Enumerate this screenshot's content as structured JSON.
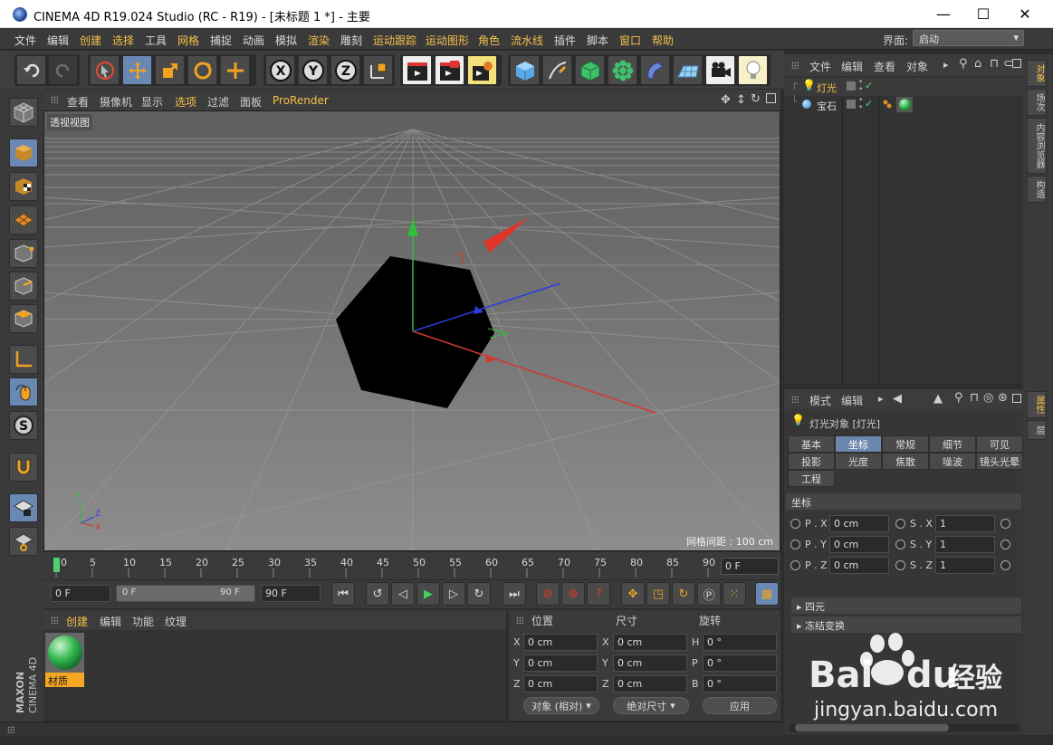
{
  "window": {
    "title": "CINEMA 4D R19.024 Studio (RC - R19) - [未标题 1 *] - 主要",
    "minimize": "—",
    "maximize": "☐",
    "close": "✕"
  },
  "menubar": {
    "items": [
      "文件",
      "编辑",
      "创建",
      "选择",
      "工具",
      "网格",
      "捕捉",
      "动画",
      "模拟",
      "渲染",
      "雕刻",
      "运动跟踪",
      "运动图形",
      "角色",
      "流水线",
      "插件",
      "脚本",
      "窗口",
      "帮助"
    ],
    "layout_label": "界面:",
    "layout_value": "启动"
  },
  "viewport": {
    "menu": [
      "查看",
      "摄像机",
      "显示",
      "选项",
      "过滤",
      "面板",
      "ProRender"
    ],
    "label": "透视视图",
    "grid_spacing": "网格间距 : 100 cm"
  },
  "timeline": {
    "ticks": [
      "0",
      "5",
      "10",
      "15",
      "20",
      "25",
      "30",
      "35",
      "40",
      "45",
      "50",
      "55",
      "60",
      "65",
      "70",
      "75",
      "80",
      "85",
      "90"
    ],
    "current_frame": "0 F",
    "start_frame": "0 F",
    "range_start": "0 F",
    "range_end": "90 F",
    "end_frame": "90 F"
  },
  "material_manager": {
    "menu": [
      "创建",
      "编辑",
      "功能",
      "纹理"
    ],
    "materials": [
      {
        "name": "材质"
      }
    ]
  },
  "coordinates": {
    "headers": {
      "position": "位置",
      "size": "尺寸",
      "rotation": "旋转"
    },
    "rows": [
      {
        "pos_label": "X",
        "pos": "0 cm",
        "size_label": "X",
        "size": "0 cm",
        "rot_label": "H",
        "rot": "0 °"
      },
      {
        "pos_label": "Y",
        "pos": "0 cm",
        "size_label": "Y",
        "size": "0 cm",
        "rot_label": "P",
        "rot": "0 °"
      },
      {
        "pos_label": "Z",
        "pos": "0 cm",
        "size_label": "Z",
        "size": "0 cm",
        "rot_label": "B",
        "rot": "0 °"
      }
    ],
    "mode": "对象 (相对)",
    "size_mode": "绝对尺寸",
    "apply": "应用"
  },
  "object_manager": {
    "menu": [
      "文件",
      "编辑",
      "查看",
      "对象"
    ],
    "objects": [
      {
        "name": "灯光"
      },
      {
        "name": "宝石"
      }
    ]
  },
  "attribute_manager": {
    "menu": [
      "模式",
      "编辑"
    ],
    "object_title": "灯光对象 [灯光]",
    "tabs_row1": [
      "基本",
      "坐标",
      "常规",
      "细节",
      "可见"
    ],
    "tabs_row2": [
      "投影",
      "光度",
      "焦散",
      "噪波",
      "镜头光晕"
    ],
    "tabs_row3": [
      "工程"
    ],
    "section": "坐标",
    "params": [
      {
        "p_label": "P . X",
        "p_value": "0 cm",
        "s_label": "S . X",
        "s_value": "1"
      },
      {
        "p_label": "P . Y",
        "p_value": "0 cm",
        "s_label": "S . Y",
        "s_value": "1"
      },
      {
        "p_label": "P . Z",
        "p_value": "0 cm",
        "s_label": "S . Z",
        "s_value": "1"
      }
    ],
    "quaternion": "四元",
    "freeze": "冻结变换"
  },
  "right_tabs": {
    "top": [
      "对象",
      "场次",
      "内容浏览器",
      "构造"
    ],
    "bottom": [
      "属性",
      "层"
    ]
  },
  "branding": {
    "maxon": "MAXON",
    "product": "CINEMA 4D"
  },
  "watermark": {
    "brand": "Bai",
    "brand2": "du",
    "cn": "经验",
    "url": "jingyan.baidu.com"
  },
  "colors": {
    "accent": "#f5c04a",
    "active_tab": "#6c87ad"
  }
}
